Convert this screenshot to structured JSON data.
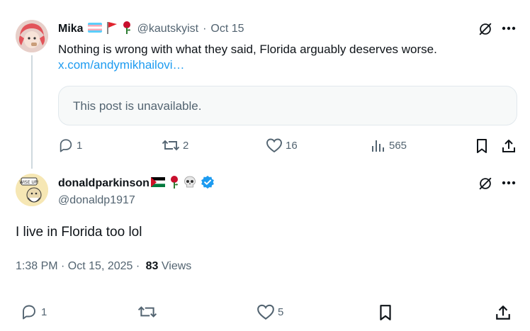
{
  "quoted_post": {
    "author_name": "Mika",
    "author_handle": "@kautskyist",
    "separator": "·",
    "date": "Oct 15",
    "text": "Nothing is wrong with what they said, Florida arguably deserves worse.",
    "link": "x.com/andymikhailovi…",
    "card_text": "This post is unavailable.",
    "stats": {
      "replies": "1",
      "reposts": "2",
      "likes": "16",
      "views": "565"
    }
  },
  "main_post": {
    "author_name": "donaldparkinson",
    "author_handle": "@donaldp1917",
    "text": "I live in Florida too lol",
    "time": "1:38 PM · Oct 15, 2025 ·",
    "views_count": "83",
    "views_label": "Views",
    "stats": {
      "replies": "1",
      "likes": "5"
    }
  },
  "colors": {
    "verified": "#1d9bf0",
    "muted": "#536471",
    "link": "#1d9bf0"
  },
  "icons": [
    "grok-icon",
    "more-icon",
    "reply-icon",
    "repost-icon",
    "like-icon",
    "views-icon",
    "bookmark-icon",
    "share-icon",
    "verified-badge-icon"
  ]
}
